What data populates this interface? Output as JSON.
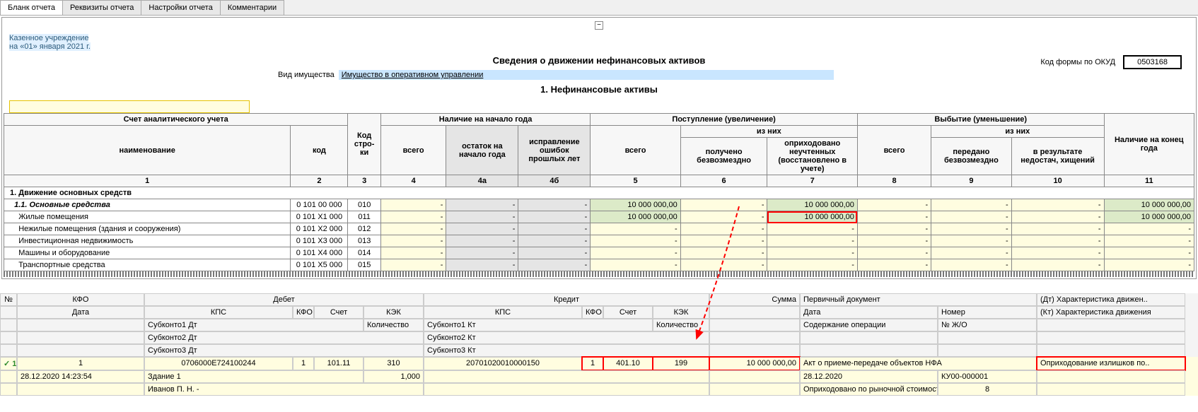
{
  "tabs": [
    "Бланк отчета",
    "Реквизиты отчета",
    "Настройки отчета",
    "Комментарии"
  ],
  "org": {
    "name": "Казенное учреждение",
    "date": "на «01» января 2021 г."
  },
  "title": "Сведения о движении нефинансовых активов",
  "okud": {
    "label": "Код формы по ОКУД",
    "value": "0503168"
  },
  "property": {
    "label": "Вид имущества",
    "value": "Имущество в оперативном управлении"
  },
  "section1": "1. Нефинансовые активы",
  "headers": {
    "acct": "Счет аналитического учета",
    "name": "наименование",
    "code": "код",
    "row": "Код стро-ки",
    "begin": "Наличие на начало года",
    "total": "всего",
    "balance": "остаток на начало года",
    "corrections": "исправление ошибок прошлых лет",
    "receipt": "Поступление (увеличение)",
    "ofwhich": "из них",
    "free": "получено безвозмездно",
    "unaccounted": "оприходовано неучтенных (восстановлено в учете)",
    "disposal": "Выбытие (уменьшение)",
    "transferred": "передано безвозмездно",
    "shortage": "в результате недостач, хищений",
    "end": "Наличие на конец года"
  },
  "colnums": [
    "1",
    "2",
    "3",
    "4",
    "4а",
    "4б",
    "5",
    "6",
    "7",
    "8",
    "9",
    "10",
    "11"
  ],
  "section_row": "1. Движение основных средств",
  "rows": [
    {
      "name": "1.1. Основные средства",
      "code": "0 101 00 000",
      "row": "010",
      "c5": "10 000 000,00",
      "c7": "10 000 000,00",
      "c11": "10 000 000,00",
      "style": "it"
    },
    {
      "name": "Жилые помещения",
      "code": "0 101 X1 000",
      "row": "011",
      "c5": "10 000 000,00",
      "c7": "10 000 000,00",
      "c11": "10 000 000,00",
      "hl7": true
    },
    {
      "name": "Нежилые помещения (здания и сооружения)",
      "code": "0 101 X2 000",
      "row": "012"
    },
    {
      "name": "Инвестиционная недвижимость",
      "code": "0 101 X3 000",
      "row": "013"
    },
    {
      "name": "Машины и оборудование",
      "code": "0 101 X4 000",
      "row": "014"
    },
    {
      "name": "Транспортные средства",
      "code": "0 101 X5 000",
      "row": "015"
    }
  ],
  "journal_headers": {
    "num": "№",
    "kfo": "КФО",
    "debit": "Дебет",
    "credit": "Кредит",
    "sum": "Сумма",
    "primary": "Первичный документ",
    "char_dt": "(Дт) Характеристика движен..",
    "date": "Дата",
    "kps": "КПС",
    "kfo2": "КФО",
    "acct": "Счет",
    "kek": "КЭК",
    "char_kt": "(Кт) Характеристика движения",
    "num2": "Номер",
    "sub1dt": "Субконто1 Дт",
    "qty": "Количество",
    "sub1kt": "Субконто1 Кт",
    "content": "Содержание операции",
    "zho": "№ Ж/О",
    "sub2dt": "Субконто2 Дт",
    "sub2kt": "Субконто2 Кт",
    "sub3dt": "Субконто3 Дт",
    "sub3kt": "Субконто3 Кт"
  },
  "journal_row": {
    "num": "1",
    "kfo": "1",
    "kps_dt": "0706000Е724100244",
    "kfo_dt": "1",
    "acct_dt": "101.11",
    "kek_dt": "310",
    "kps_kt": "20701020010000150",
    "kfo_kt": "1",
    "acct_kt": "401.10",
    "kek_kt": "199",
    "sum": "10 000 000,00",
    "primary": "Акт о приеме-передаче объектов НФА",
    "char_kt_val": "Оприходование излишков по..",
    "date": "28.12.2020 14:23:54",
    "doc_date": "28.12.2020",
    "doc_num": "КУ00-000001",
    "sub1dt": "Здание 1",
    "qty": "1,000",
    "content": "Оприходовано по рыночной стоимости инв. ..",
    "zho": "8",
    "sub2dt": "Иванов П. Н. -"
  }
}
